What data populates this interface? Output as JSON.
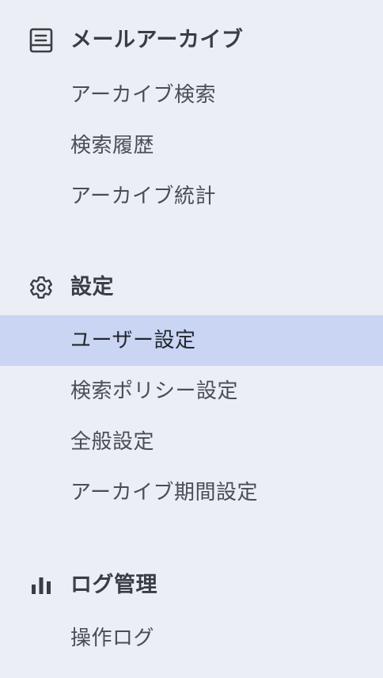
{
  "sidebar": {
    "sections": [
      {
        "icon": "archive-list-icon",
        "title": "メールアーカイブ",
        "items": [
          {
            "label": "アーカイブ検索"
          },
          {
            "label": "検索履歴"
          },
          {
            "label": "アーカイブ統計"
          }
        ]
      },
      {
        "icon": "gear-icon",
        "title": "設定",
        "items": [
          {
            "label": "ユーザー設定",
            "active": true
          },
          {
            "label": "検索ポリシー設定"
          },
          {
            "label": "全般設定"
          },
          {
            "label": "アーカイブ期間設定"
          }
        ]
      },
      {
        "icon": "bar-chart-icon",
        "title": "ログ管理",
        "items": [
          {
            "label": "操作ログ"
          }
        ]
      }
    ]
  },
  "colors": {
    "background": "#eceef5",
    "active_background": "#c9d5f2",
    "header_text": "#3a3d44",
    "item_text": "#4a4d55"
  }
}
